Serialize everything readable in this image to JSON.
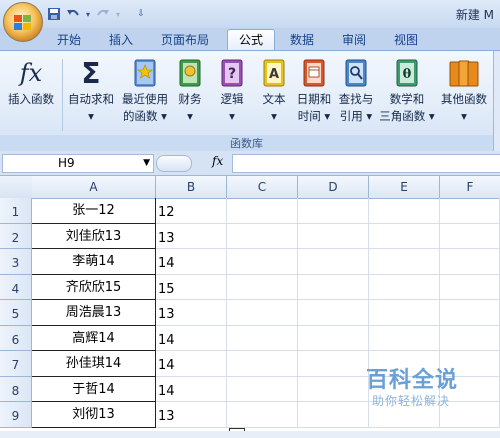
{
  "title_bar": {
    "text": "新建 M"
  },
  "tabs": [
    {
      "label": "开始"
    },
    {
      "label": "插入"
    },
    {
      "label": "页面布局"
    },
    {
      "label": "公式",
      "active": true
    },
    {
      "label": "数据"
    },
    {
      "label": "审阅"
    },
    {
      "label": "视图"
    }
  ],
  "ribbon": {
    "group_label": "函数库",
    "buttons": [
      {
        "line1": "插入函数",
        "line2": "",
        "icon": "fx-icon"
      },
      {
        "line1": "自动求和",
        "line2": "▾",
        "icon": "sigma-icon"
      },
      {
        "line1": "最近使用",
        "line2": "的函数 ▾",
        "icon": "star-book-icon"
      },
      {
        "line1": "财务",
        "line2": "▾",
        "icon": "finance-book-icon"
      },
      {
        "line1": "逻辑",
        "line2": "▾",
        "icon": "logic-book-icon"
      },
      {
        "line1": "文本",
        "line2": "▾",
        "icon": "text-book-icon"
      },
      {
        "line1": "日期和",
        "line2": "时间 ▾",
        "icon": "date-book-icon"
      },
      {
        "line1": "查找与",
        "line2": "引用 ▾",
        "icon": "lookup-book-icon"
      },
      {
        "line1": "数学和",
        "line2": "三角函数 ▾",
        "icon": "math-book-icon"
      },
      {
        "line1": "其他函数",
        "line2": "▾",
        "icon": "more-books-icon"
      }
    ]
  },
  "formula_bar": {
    "name_box": "H9",
    "fx_label": "fx",
    "formula": ""
  },
  "grid": {
    "columns": [
      "A",
      "B",
      "C",
      "D",
      "E",
      "F"
    ],
    "rows": [
      {
        "n": "1",
        "a": "张一12",
        "b": "12"
      },
      {
        "n": "2",
        "a": "刘佳欣13",
        "b": "13"
      },
      {
        "n": "3",
        "a": "李萌14",
        "b": "14"
      },
      {
        "n": "4",
        "a": "齐欣欣15",
        "b": "15"
      },
      {
        "n": "5",
        "a": "周浩晨13",
        "b": "13"
      },
      {
        "n": "6",
        "a": "高辉14",
        "b": "14"
      },
      {
        "n": "7",
        "a": "孙佳琪14",
        "b": "14"
      },
      {
        "n": "8",
        "a": "于哲14",
        "b": "14"
      },
      {
        "n": "9",
        "a": "刘彻13",
        "b": "13"
      }
    ]
  },
  "watermark": {
    "title": "百科全说",
    "subtitle": "助你轻松解决"
  }
}
